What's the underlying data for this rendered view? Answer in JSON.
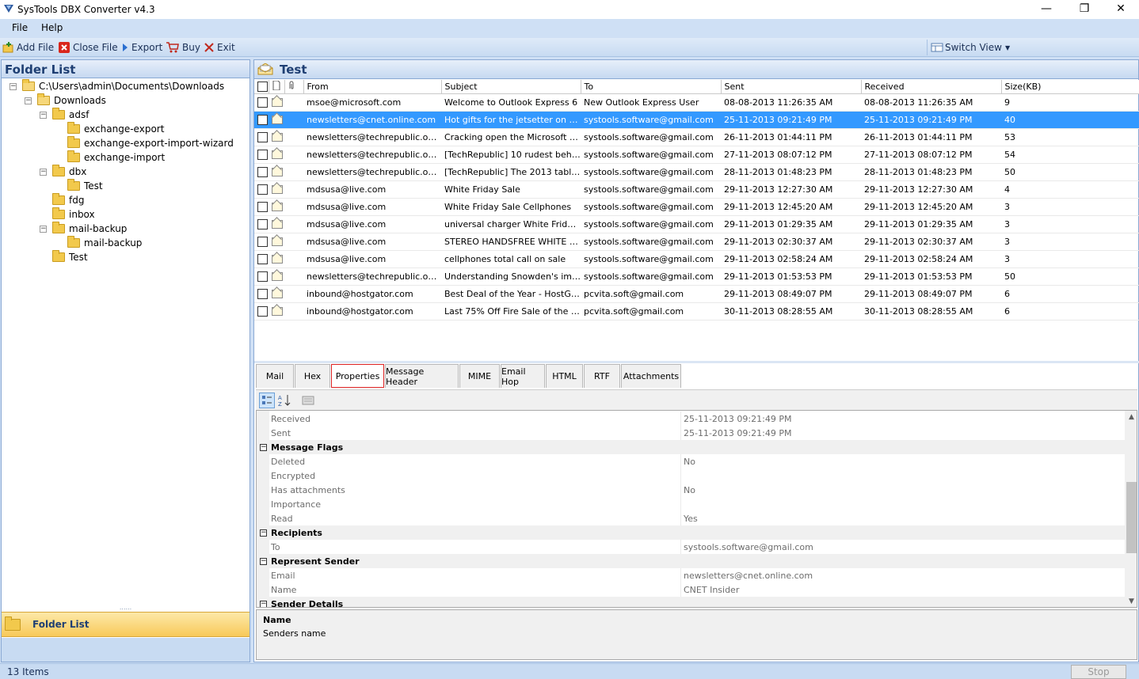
{
  "window": {
    "title": "SysTools DBX Converter v4.3",
    "minimize": "—",
    "restore": "❐",
    "close": "✕"
  },
  "menu": [
    "File",
    "Help"
  ],
  "toolbar": {
    "add_file": "Add File",
    "close_file": "Close File",
    "export": "Export",
    "buy": "Buy",
    "exit": "Exit",
    "switch_view": "Switch View"
  },
  "left_panel": {
    "header": "Folder List",
    "tree": [
      {
        "label": "C:\\Users\\admin\\Documents\\Downloads",
        "level": 0,
        "expander": "−",
        "open": true
      },
      {
        "label": "Downloads",
        "level": 1,
        "expander": "−",
        "open": true
      },
      {
        "label": "adsf",
        "level": 2,
        "expander": "−"
      },
      {
        "label": "exchange-export",
        "level": 3,
        "expander": ""
      },
      {
        "label": "exchange-export-import-wizard",
        "level": 3,
        "expander": ""
      },
      {
        "label": "exchange-import",
        "level": 3,
        "expander": ""
      },
      {
        "label": "dbx",
        "level": 2,
        "expander": "−"
      },
      {
        "label": "Test",
        "level": 3,
        "expander": ""
      },
      {
        "label": "fdg",
        "level": 2,
        "expander": ""
      },
      {
        "label": "inbox",
        "level": 2,
        "expander": ""
      },
      {
        "label": "mail-backup",
        "level": 2,
        "expander": "−"
      },
      {
        "label": "mail-backup",
        "level": 3,
        "expander": ""
      },
      {
        "label": "Test",
        "level": 2,
        "expander": ""
      }
    ],
    "grip": "......",
    "folder_list_button": "Folder List"
  },
  "right_panel": {
    "header": "Test",
    "columns": [
      "From",
      "Subject",
      "To",
      "Sent",
      "Received",
      "Size(KB)"
    ],
    "rows": [
      {
        "from": "msoe@microsoft.com",
        "subject": "Welcome to Outlook Express 6",
        "to": "New Outlook Express User",
        "sent": "08-08-2013 11:26:35 AM",
        "received": "08-08-2013 11:26:35 AM",
        "size": "9",
        "selected": false
      },
      {
        "from": "newsletters@cnet.online.com",
        "subject": "Hot gifts for the jetsetter on yo...",
        "to": "systools.software@gmail.com",
        "sent": "25-11-2013 09:21:49 PM",
        "received": "25-11-2013 09:21:49 PM",
        "size": "40",
        "selected": true
      },
      {
        "from": "newsletters@techrepublic.onli...",
        "subject": "Cracking open the Microsoft S...",
        "to": "systools.software@gmail.com",
        "sent": "26-11-2013 01:44:11 PM",
        "received": "26-11-2013 01:44:11 PM",
        "size": "53",
        "selected": false
      },
      {
        "from": "newsletters@techrepublic.onli...",
        "subject": "[TechRepublic] 10 rudest behav...",
        "to": "systools.software@gmail.com",
        "sent": "27-11-2013 08:07:12 PM",
        "received": "27-11-2013 08:07:12 PM",
        "size": "54",
        "selected": false
      },
      {
        "from": "newsletters@techrepublic.onli...",
        "subject": "[TechRepublic] The 2013 tablet ...",
        "to": "systools.software@gmail.com",
        "sent": "28-11-2013 01:48:23 PM",
        "received": "28-11-2013 01:48:23 PM",
        "size": "50",
        "selected": false
      },
      {
        "from": "mdsusa@live.com",
        "subject": "White Friday Sale",
        "to": "systools.software@gmail.com",
        "sent": "29-11-2013 12:27:30 AM",
        "received": "29-11-2013 12:27:30 AM",
        "size": "4",
        "selected": false
      },
      {
        "from": "mdsusa@live.com",
        "subject": "White Friday Sale Cellphones",
        "to": "systools.software@gmail.com",
        "sent": "29-11-2013 12:45:20 AM",
        "received": "29-11-2013 12:45:20 AM",
        "size": "3",
        "selected": false
      },
      {
        "from": "mdsusa@live.com",
        "subject": "universal charger White Friday ...",
        "to": "systools.software@gmail.com",
        "sent": "29-11-2013 01:29:35 AM",
        "received": "29-11-2013 01:29:35 AM",
        "size": "3",
        "selected": false
      },
      {
        "from": "mdsusa@live.com",
        "subject": "STEREO HANDSFREE WHITE FRI...",
        "to": "systools.software@gmail.com",
        "sent": "29-11-2013 02:30:37 AM",
        "received": "29-11-2013 02:30:37 AM",
        "size": "3",
        "selected": false
      },
      {
        "from": "mdsusa@live.com",
        "subject": "cellphones total call on sale",
        "to": "systools.software@gmail.com",
        "sent": "29-11-2013 02:58:24 AM",
        "received": "29-11-2013 02:58:24 AM",
        "size": "3",
        "selected": false
      },
      {
        "from": "newsletters@techrepublic.onli...",
        "subject": "Understanding Snowden's imp...",
        "to": "systools.software@gmail.com",
        "sent": "29-11-2013 01:53:53 PM",
        "received": "29-11-2013 01:53:53 PM",
        "size": "50",
        "selected": false
      },
      {
        "from": "inbound@hostgator.com",
        "subject": "Best Deal of the Year - HostGat...",
        "to": "pcvita.soft@gmail.com",
        "sent": "29-11-2013 08:49:07 PM",
        "received": "29-11-2013 08:49:07 PM",
        "size": "6",
        "selected": false
      },
      {
        "from": "inbound@hostgator.com",
        "subject": "Last 75% Off Fire Sale of the D...",
        "to": "pcvita.soft@gmail.com",
        "sent": "30-11-2013 08:28:55 AM",
        "received": "30-11-2013 08:28:55 AM",
        "size": "6",
        "selected": false
      }
    ],
    "tabs": [
      {
        "label": "Mail",
        "active": false
      },
      {
        "label": "Hex",
        "active": false
      },
      {
        "label": "Properties",
        "active": true
      },
      {
        "label": "Message Header",
        "active": false
      },
      {
        "label": "MIME",
        "active": false
      },
      {
        "label": "Email Hop",
        "active": false
      },
      {
        "label": "HTML",
        "active": false
      },
      {
        "label": "RTF",
        "active": false
      },
      {
        "label": "Attachments",
        "active": false
      }
    ],
    "properties": [
      {
        "type": "row",
        "label": "Received",
        "value": "25-11-2013 09:21:49 PM"
      },
      {
        "type": "row",
        "label": "Sent",
        "value": "25-11-2013 09:21:49 PM"
      },
      {
        "type": "cat",
        "label": "Message Flags",
        "value": ""
      },
      {
        "type": "row",
        "label": "Deleted",
        "value": "No"
      },
      {
        "type": "row",
        "label": "Encrypted",
        "value": ""
      },
      {
        "type": "row",
        "label": "Has attachments",
        "value": "No"
      },
      {
        "type": "row",
        "label": "Importance",
        "value": ""
      },
      {
        "type": "row",
        "label": "Read",
        "value": "Yes"
      },
      {
        "type": "cat",
        "label": "Recipients",
        "value": ""
      },
      {
        "type": "row",
        "label": "To",
        "value": "systools.software@gmail.com"
      },
      {
        "type": "cat",
        "label": "Represent Sender",
        "value": ""
      },
      {
        "type": "row",
        "label": "Email",
        "value": "newsletters@cnet.online.com"
      },
      {
        "type": "row",
        "label": "Name",
        "value": "CNET Insider"
      },
      {
        "type": "cat",
        "label": "Sender Details",
        "value": ""
      }
    ],
    "description": {
      "name": "Name",
      "text": "Senders name"
    }
  },
  "status": {
    "items": "13 Items",
    "stop": "Stop"
  },
  "colors": {
    "selection": "#3399ff",
    "chrome": "#cfe0f5",
    "folder": "#f2c94c",
    "active_tab_border": "#dd2222"
  }
}
